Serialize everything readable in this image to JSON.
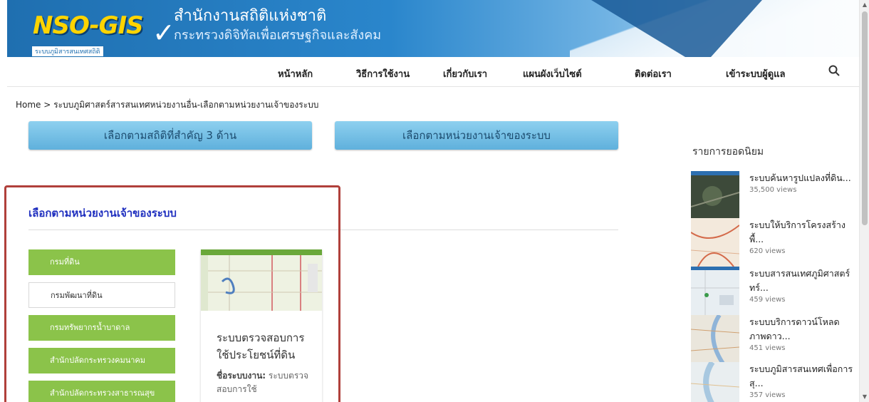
{
  "header": {
    "logo_text": "NSO-GIS",
    "logo_sub": "ระบบภูมิสารสนเทศสถิติ",
    "title": "สำนักงานสถิติแห่งชาติ",
    "subtitle": "กระทรวงดิจิทัลเพื่อเศรษฐกิจและสังคม"
  },
  "nav": {
    "items": [
      "หน้าหลัก",
      "วิธีการใช้งาน",
      "เกี่ยวกับเรา",
      "แผนผังเว็บไซต์",
      "ติดต่อเรา",
      "เข้าระบบผู้ดูแล"
    ],
    "search_icon": "search-icon"
  },
  "breadcrumb": "Home > ระบบภูมิศาสตร์สารสนเทศหน่วยงานอื่น-เลือกตามหน่วยงานเจ้าของระบบ",
  "buttons": {
    "by_stats": "เลือกตามสถิติที่สำคัญ 3 ด้าน",
    "by_agency": "เลือกตามหน่วยงานเจ้าของระบบ"
  },
  "section": {
    "title": "เลือกตามหน่วยงานเจ้าของระบบ",
    "agencies": [
      "กรมที่ดิน",
      "กรมพัฒนาที่ดิน",
      "กรมทรัพยากรน้ำบาดาล",
      "สำนักปลัดกระทรวงคมนาคม",
      "สำนักปลัดกระทรวงสาธารณสุข"
    ],
    "card": {
      "title": "ระบบตรวจสอบการใช้ประโยชน์ที่ดิน",
      "desc_label": "ชื่อระบบงาน:",
      "desc_text": "ระบบตรวจสอบการใช้"
    }
  },
  "sidebar": {
    "heading": "รายการยอดนิยม",
    "items": [
      {
        "title": "ระบบค้นหารูปแปลงที่ดิน...",
        "views": "35,500 views"
      },
      {
        "title": "ระบบให้บริการโครงสร้างพื้...",
        "views": "620 views"
      },
      {
        "title": "ระบบสารสนเทศภูมิศาสตร์ทร์...",
        "views": "459 views"
      },
      {
        "title": "ระบบบริการดาวน์โหลดภาพดาว...",
        "views": "451 views"
      },
      {
        "title": "ระบบภูมิสารสนเทศเพื่อการสุ...",
        "views": "357 views"
      }
    ]
  },
  "colors": {
    "accent_blue": "#5fb0dc",
    "agency_green": "#8bc34a",
    "highlight": "#b0403b",
    "title_blue": "#1f2fbf"
  }
}
